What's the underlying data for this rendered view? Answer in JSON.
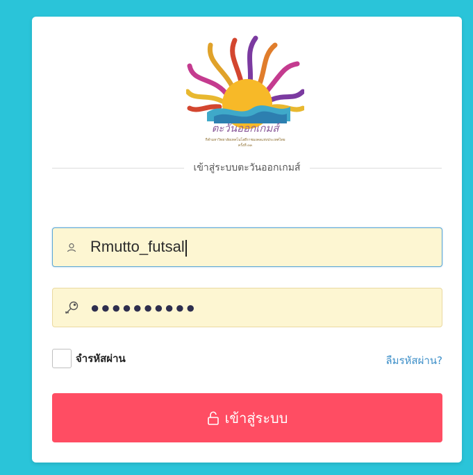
{
  "login": {
    "logo_title": "ตะวันออกเกมส์",
    "logo_subtitle": "กีฬามหาวิทยาลัยเทคโนโลยีราชมงคลแห่งประเทศไทย",
    "logo_edition": "ครั้งที่ ๓๓",
    "divider_text": "เข้าสู่ระบบตะวันออกเกมส์",
    "username_value": "Rmutto_futsal",
    "password_masked": "●●●●●●●●●●",
    "remember_label": "จำรหัสผ่าน",
    "remember_checked": false,
    "forgot_link": "ลืมรหัสผ่าน?",
    "login_button_label": "เข้าสู่ระบบ"
  },
  "icons": {
    "username": "user-icon",
    "password": "key-icon",
    "login": "unlock-icon"
  },
  "colors": {
    "background": "#2ac4d9",
    "input_bg": "#fdf6d2",
    "button": "#ff4d63",
    "link": "#3d8fc8"
  }
}
